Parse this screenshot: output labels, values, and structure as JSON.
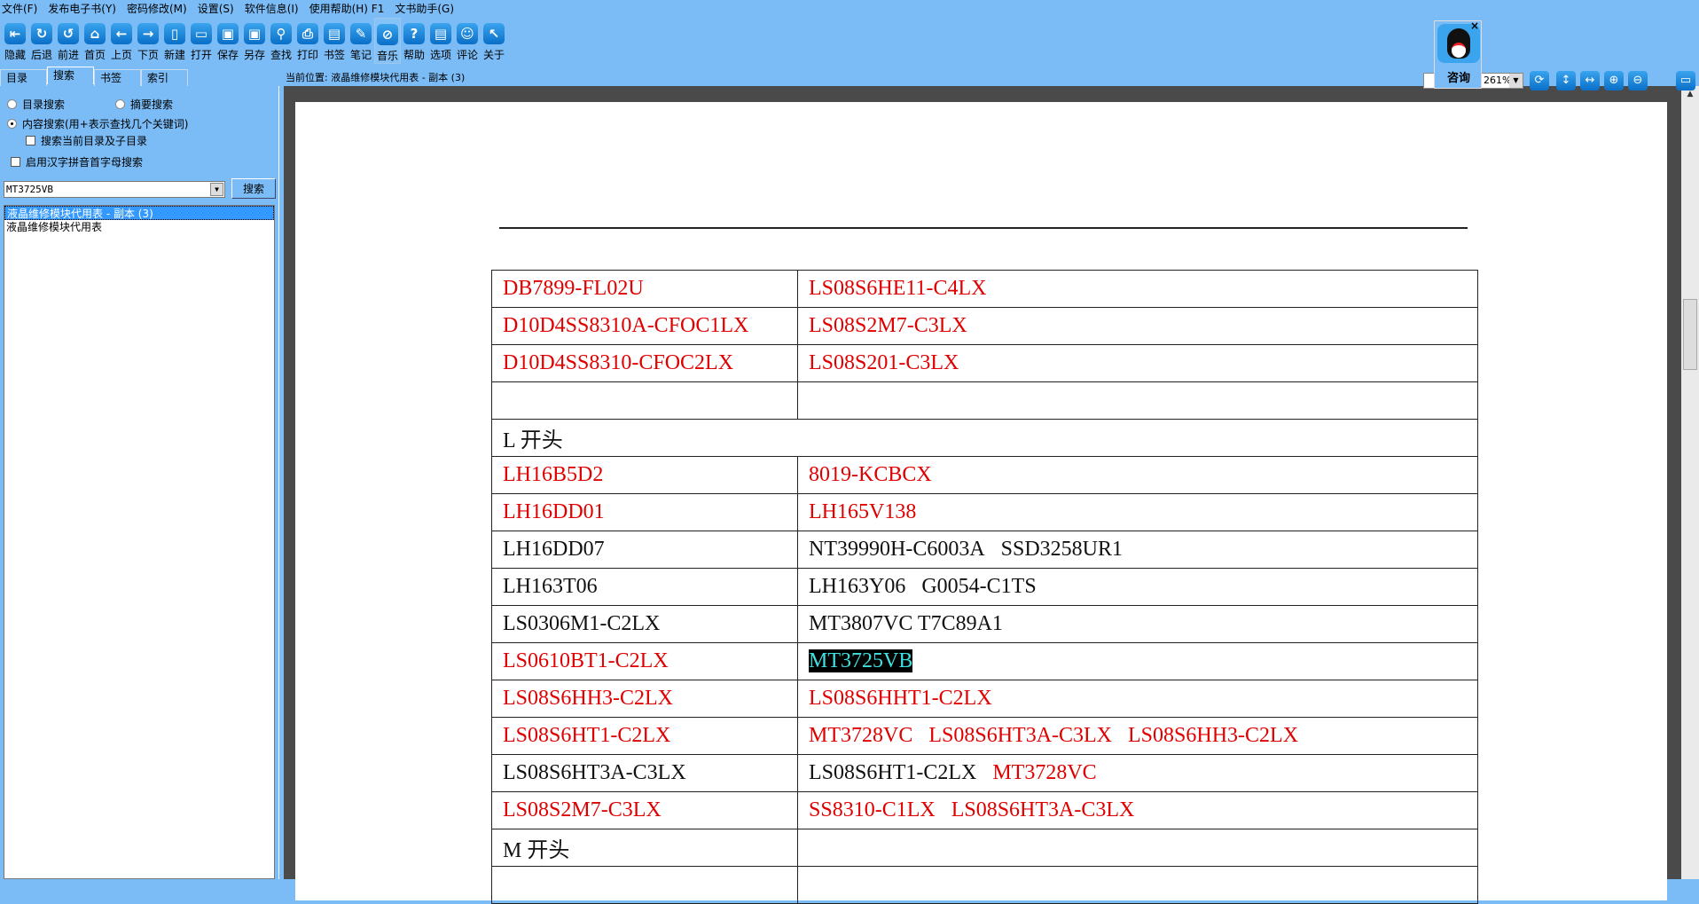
{
  "menu": [
    "文件(F)",
    "发布电子书(Y)",
    "密码修改(M)",
    "设置(S)",
    "软件信息(I)",
    "使用帮助(H) F1",
    "文书助手(G)"
  ],
  "toolbar": [
    {
      "label": "隐藏",
      "icon": "hide-icon",
      "glyph": "⇤"
    },
    {
      "label": "后退",
      "icon": "back-rotate-icon",
      "glyph": "↻"
    },
    {
      "label": "前进",
      "icon": "forward-rotate-icon",
      "glyph": "↺"
    },
    {
      "label": "首页",
      "icon": "home-icon",
      "glyph": "⌂"
    },
    {
      "label": "上页",
      "icon": "arrow-left-icon",
      "glyph": "←"
    },
    {
      "label": "下页",
      "icon": "arrow-right-icon",
      "glyph": "→"
    },
    {
      "label": "新建",
      "icon": "new-file-icon",
      "glyph": "▯"
    },
    {
      "label": "打开",
      "icon": "open-folder-icon",
      "glyph": "▭"
    },
    {
      "label": "保存",
      "icon": "save-icon",
      "glyph": "▣"
    },
    {
      "label": "另存",
      "icon": "save-as-icon",
      "glyph": "▣"
    },
    {
      "label": "查找",
      "icon": "search-icon",
      "glyph": "⚲"
    },
    {
      "label": "打印",
      "icon": "print-icon",
      "glyph": "⎙"
    },
    {
      "label": "书签",
      "icon": "bookmark-icon",
      "glyph": "▤"
    },
    {
      "label": "笔记",
      "icon": "note-icon",
      "glyph": "✎"
    },
    {
      "label": "音乐",
      "icon": "music-icon",
      "glyph": "⊘"
    },
    {
      "label": "帮助",
      "icon": "help-icon",
      "glyph": "?"
    },
    {
      "label": "选项",
      "icon": "options-icon",
      "glyph": "▤"
    },
    {
      "label": "评论",
      "icon": "smiley-icon",
      "glyph": "☺"
    },
    {
      "label": "关于",
      "icon": "cursor-icon",
      "glyph": "↖"
    }
  ],
  "tabs": [
    "目录",
    "搜索",
    "书签",
    "索引"
  ],
  "search": {
    "opt_catalog": "目录搜索",
    "opt_summary": "摘要搜索",
    "opt_content": "内容搜索(用+表示查找几个关键词)",
    "opt_subdir": "搜索当前目录及子目录",
    "opt_pinyin": "启用汉字拼音首字母搜索",
    "query": "MT3725VB",
    "button": "搜索",
    "results": [
      "液晶维修模块代用表 - 副本 (3)",
      "液晶维修模块代用表"
    ]
  },
  "location": "当前位置: 液晶维修模块代用表 - 副本 (3)",
  "zoom": "261%",
  "qq_label": "咨询",
  "table": [
    [
      [
        {
          "t": "DB7899-FL02U",
          "c": "red"
        }
      ],
      [
        {
          "t": "LS08S6HE11-C4LX",
          "c": "red"
        }
      ]
    ],
    [
      [
        {
          "t": "D10D4SS8310A-CFOC1LX",
          "c": "red"
        }
      ],
      [
        {
          "t": "LS08S2M7-C3LX",
          "c": "red"
        }
      ]
    ],
    [
      [
        {
          "t": "D10D4SS8310-CFOC2LX",
          "c": "red"
        }
      ],
      [
        {
          "t": "LS08S201-C3LX",
          "c": "red"
        }
      ]
    ],
    [
      [],
      []
    ],
    [
      [
        {
          "t": "L 开头",
          "c": "blk"
        }
      ]
    ],
    [
      [
        {
          "t": "LH16B5D2",
          "c": "red"
        }
      ],
      [
        {
          "t": "8019-KCBCX",
          "c": "red"
        }
      ]
    ],
    [
      [
        {
          "t": "LH16DD01",
          "c": "red"
        }
      ],
      [
        {
          "t": "LH165V138",
          "c": "red"
        }
      ]
    ],
    [
      [
        {
          "t": "LH16DD07",
          "c": "blk"
        }
      ],
      [
        {
          "t": "NT39990H-C6003A",
          "c": "blk"
        },
        {
          "t": "SSD3258UR1",
          "c": "blk"
        }
      ]
    ],
    [
      [
        {
          "t": "LH163T06",
          "c": "blk"
        }
      ],
      [
        {
          "t": "LH163Y06",
          "c": "blk"
        },
        {
          "t": "G0054-C1TS",
          "c": "blk"
        }
      ]
    ],
    [
      [
        {
          "t": "LS0306M1-C2LX",
          "c": "blk"
        }
      ],
      [
        {
          "t": "MT3807VC T7C89A1",
          "c": "blk"
        }
      ]
    ],
    [
      [
        {
          "t": "LS0610BT1-C2LX",
          "c": "red"
        }
      ],
      [
        {
          "t": "MT3725VB",
          "c": "hl"
        }
      ]
    ],
    [
      [
        {
          "t": "LS08S6HH3-C2LX",
          "c": "red"
        }
      ],
      [
        {
          "t": "LS08S6HHT1-C2LX",
          "c": "red"
        }
      ]
    ],
    [
      [
        {
          "t": "LS08S6HT1-C2LX",
          "c": "red"
        }
      ],
      [
        {
          "t": "MT3728VC",
          "c": "red"
        },
        {
          "t": "LS08S6HT3A-C3LX",
          "c": "red"
        },
        {
          "t": "LS08S6HH3-C2LX",
          "c": "red"
        }
      ]
    ],
    [
      [
        {
          "t": "LS08S6HT3A-C3LX",
          "c": "blk"
        }
      ],
      [
        {
          "t": "LS08S6HT1-C2LX",
          "c": "blk"
        },
        {
          "t": "MT3728VC",
          "c": "red"
        }
      ]
    ],
    [
      [
        {
          "t": "LS08S2M7-C3LX",
          "c": "red"
        }
      ],
      [
        {
          "t": "SS8310-C1LX",
          "c": "red"
        },
        {
          "t": "LS08S6HT3A-C3LX",
          "c": "red"
        }
      ]
    ],
    [
      [
        {
          "t": "M 开头",
          "c": "blk"
        }
      ],
      []
    ],
    [
      [],
      []
    ]
  ]
}
